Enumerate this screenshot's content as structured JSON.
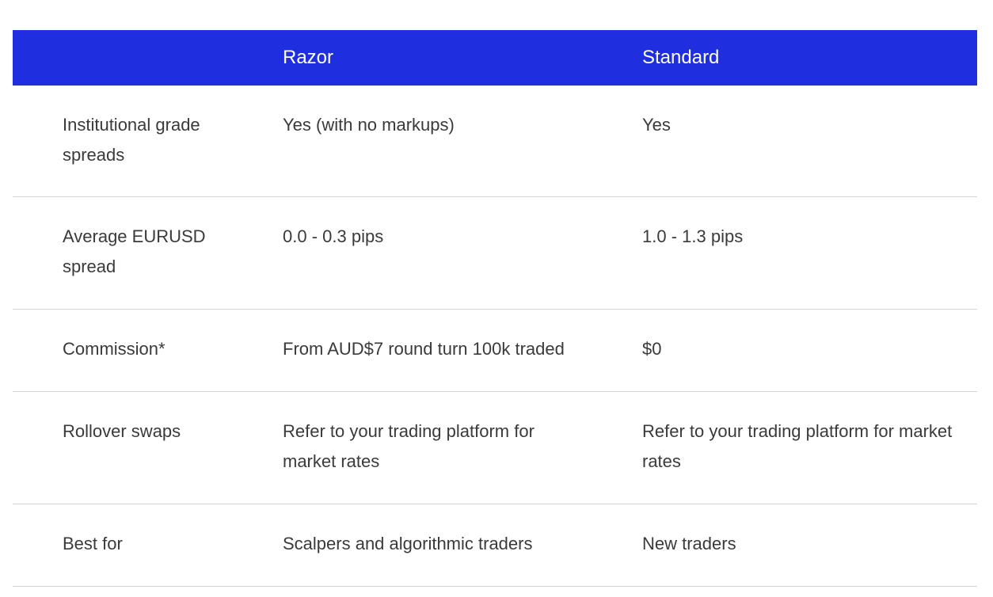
{
  "table": {
    "headers": [
      "",
      "Razor",
      "Standard"
    ],
    "rows": [
      {
        "feature": "Institutional grade spreads",
        "razor": "Yes (with no markups)",
        "standard": "Yes"
      },
      {
        "feature": "Average EURUSD spread",
        "razor": "0.0 - 0.3 pips",
        "standard": "1.0 - 1.3 pips"
      },
      {
        "feature": "Commission*",
        "razor": "From AUD$7 round turn 100k traded",
        "standard": "$0"
      },
      {
        "feature": "Rollover swaps",
        "razor": "Refer to your trading platform for market rates",
        "standard": "Refer to your trading platform for market rates"
      },
      {
        "feature": "Best for",
        "razor": "Scalpers and algorithmic traders",
        "standard": "New traders"
      }
    ]
  },
  "colors": {
    "header_bg": "#1f2fe0",
    "header_text": "#ffffff",
    "body_text": "#3a3a3a",
    "divider": "#d4d4d4"
  }
}
